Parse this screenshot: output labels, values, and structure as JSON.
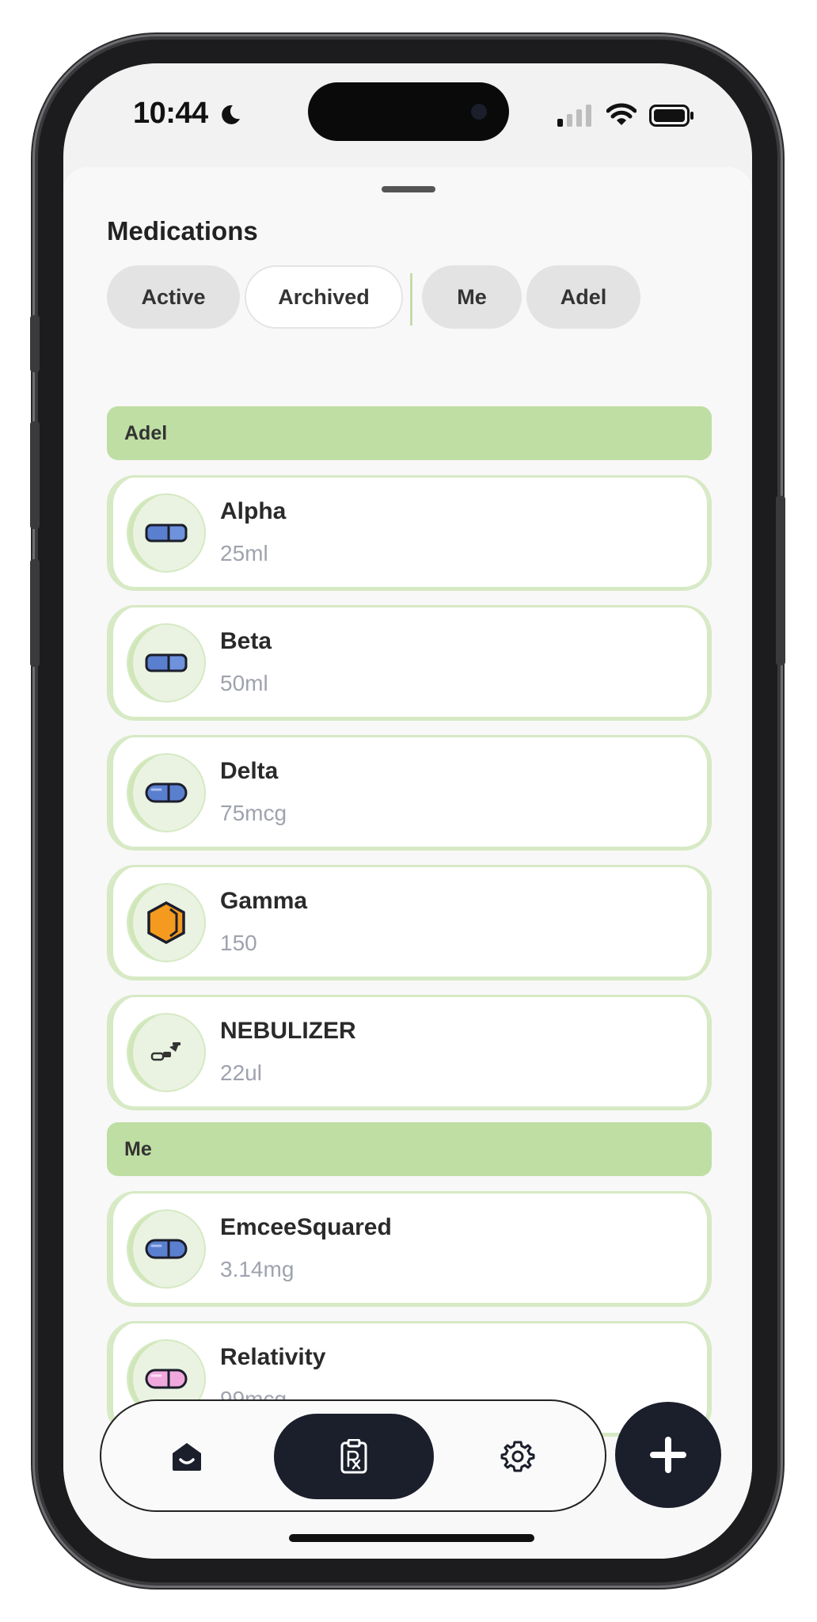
{
  "status_bar": {
    "time": "10:44",
    "moon_icon": "moon-icon",
    "signal_icon": "signal-icon",
    "wifi_icon": "wifi-icon",
    "battery_icon": "battery-icon"
  },
  "sheet": {
    "title": "Medications"
  },
  "filters": {
    "status_chips": [
      {
        "label": "Active",
        "selected": true
      },
      {
        "label": "Archived",
        "selected": false
      }
    ],
    "person_chips": [
      {
        "label": "Me",
        "selected": true
      },
      {
        "label": "Adel",
        "selected": true
      }
    ]
  },
  "groups": [
    {
      "header": "Adel",
      "medications": [
        {
          "name": "Alpha",
          "dose": "25ml",
          "icon": "pill-capsule-icon",
          "color": "#5b7fcf"
        },
        {
          "name": "Beta",
          "dose": "50ml",
          "icon": "pill-capsule-icon",
          "color": "#5b7fcf"
        },
        {
          "name": "Delta",
          "dose": "75mcg",
          "icon": "pill-rounded-icon",
          "color": "#5b7fcf"
        },
        {
          "name": "Gamma",
          "dose": "150",
          "icon": "hexagon-tablet-icon",
          "color": "#f49a1e"
        },
        {
          "name": "NEBULIZER",
          "dose": "22ul",
          "icon": "nebulizer-icon",
          "color": "#333333"
        }
      ]
    },
    {
      "header": "Me",
      "medications": [
        {
          "name": "EmceeSquared",
          "dose": "3.14mg",
          "icon": "pill-rounded-icon",
          "color": "#5b7fcf"
        },
        {
          "name": "Relativity",
          "dose": "99mcg",
          "icon": "pill-rounded-icon",
          "color": "#f0a8dc"
        }
      ]
    }
  ],
  "bottom_nav": {
    "items": [
      {
        "icon": "home-icon",
        "active": false
      },
      {
        "icon": "prescription-icon",
        "active": true
      },
      {
        "icon": "gear-icon",
        "active": false
      }
    ],
    "fab_icon": "plus-icon"
  },
  "colors": {
    "accent_green": "#bfdea3",
    "card_border": "#d6e9c4",
    "dark": "#1b1e2b",
    "dose_gray": "#9ea3ae"
  }
}
